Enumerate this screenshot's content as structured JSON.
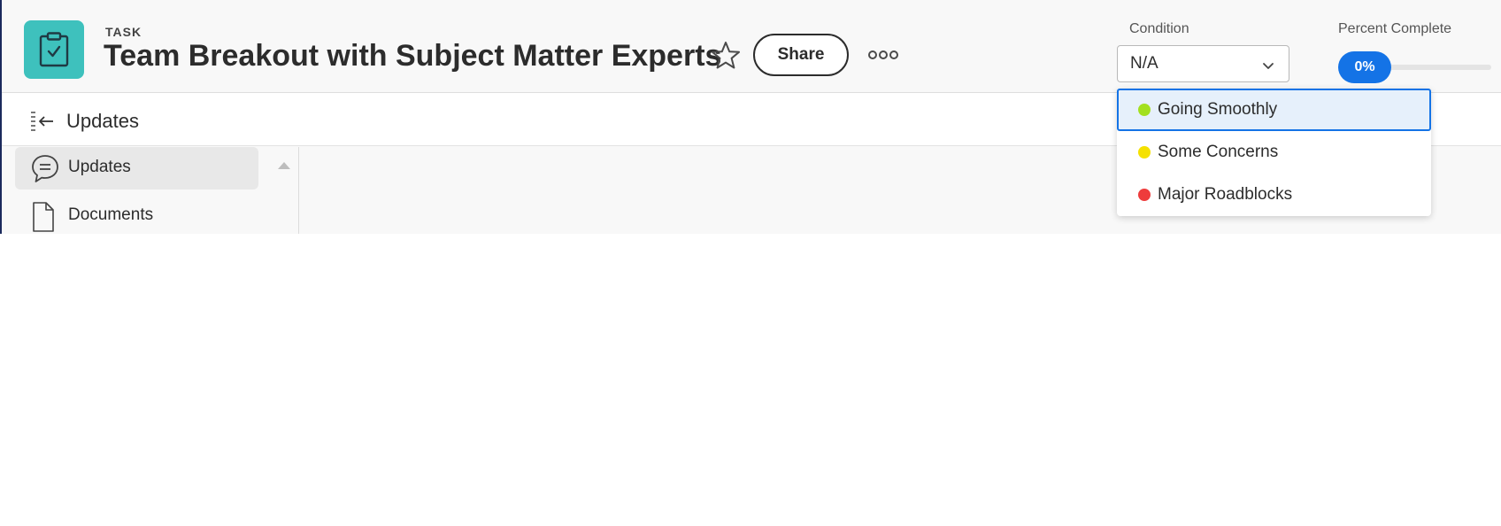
{
  "header": {
    "type_label": "TASK",
    "title": "Team Breakout with Subject Matter Experts",
    "share_label": "Share",
    "icons": {
      "task": "clipboard-check-icon",
      "favorite": "star-icon",
      "more": "more-dots-icon"
    }
  },
  "condition": {
    "label": "Condition",
    "selected": "N/A",
    "options": [
      {
        "label": "Going Smoothly",
        "color": "#a3e01e"
      },
      {
        "label": "Some Concerns",
        "color": "#f5e100"
      },
      {
        "label": "Major Roadblocks",
        "color": "#ee3c3c"
      }
    ]
  },
  "percent_complete": {
    "label": "Percent Complete",
    "value_text": "0%",
    "value": 0
  },
  "subbar": {
    "title": "Updates"
  },
  "sidebar": {
    "items": [
      {
        "label": "Updates",
        "icon": "chat-bubble-icon",
        "active": true
      },
      {
        "label": "Documents",
        "icon": "document-icon",
        "active": false
      }
    ]
  },
  "colors": {
    "accent": "#1473e6",
    "task_icon_bg": "#3ec1bd"
  }
}
